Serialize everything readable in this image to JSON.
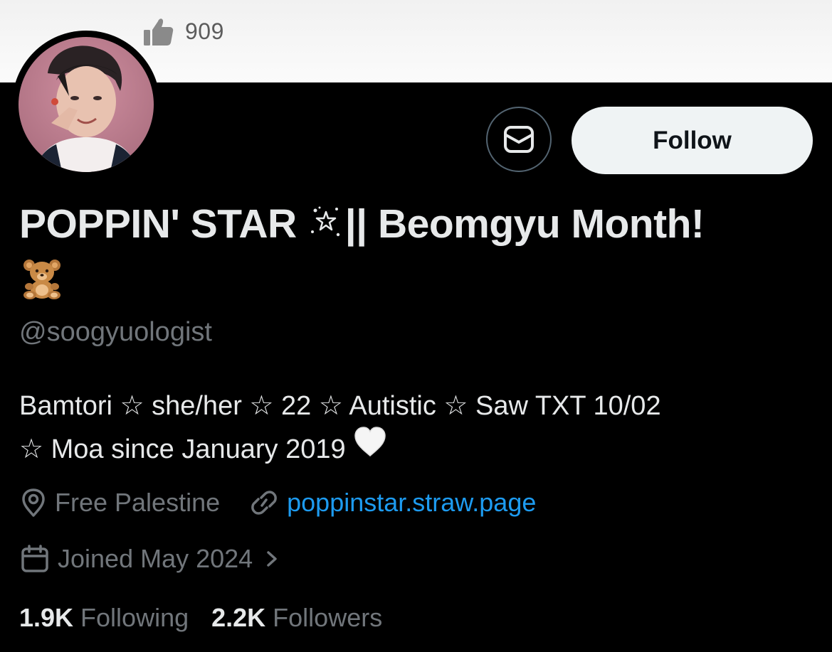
{
  "top_bar": {
    "like_count": "909",
    "like_icon": "thumbs-up-icon"
  },
  "profile": {
    "display_name_part1": "POPPIN' STAR",
    "display_name_part2": "|| Beomgyu Month!",
    "name_icons": [
      "sparkle-star-icon",
      "teddy-bear-emoji"
    ],
    "handle": "@soogyuologist",
    "bio_line1": "Bamtori ☆ she/her ☆ 22 ☆ Autistic ☆ Saw TXT 10/02",
    "bio_line2": "☆ Moa since January 2019",
    "bio_icon": "white-heart-emoji",
    "location": "Free Palestine",
    "website": "poppinstar.straw.page",
    "joined": "Joined May 2024",
    "following_count": "1.9K",
    "following_label": "Following",
    "followers_count": "2.2K",
    "followers_label": "Followers"
  },
  "actions": {
    "follow_label": "Follow",
    "message_icon": "message-icon"
  },
  "colors": {
    "background": "#000000",
    "text_primary": "#e7e9ea",
    "text_secondary": "#71767b",
    "link": "#1d9bf0",
    "follow_button_bg": "#eff3f4"
  }
}
